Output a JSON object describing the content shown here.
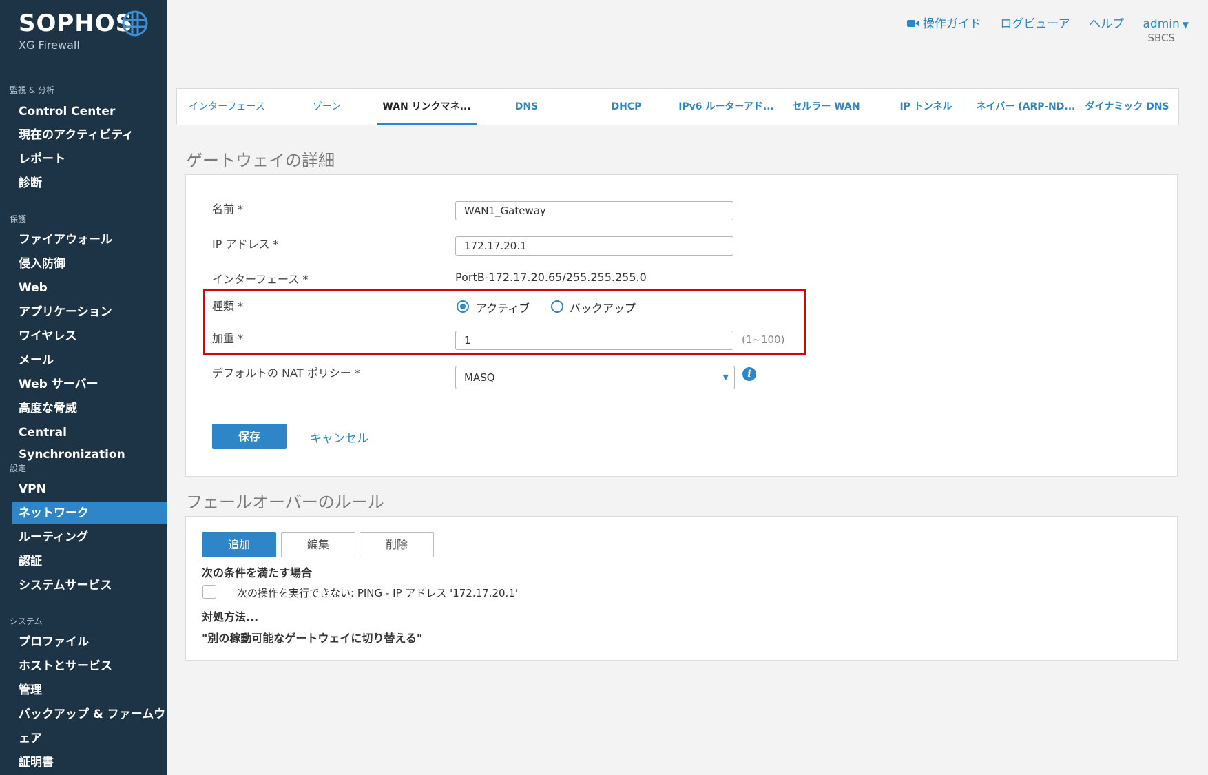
{
  "brand": {
    "name": "SOPHOS",
    "product": "XG Firewall"
  },
  "topbar": {
    "guide": "操作ガイド",
    "log_viewer": "ログビューア",
    "help": "ヘルプ",
    "user": "admin",
    "org": "SBCS"
  },
  "sidebar": {
    "sections": [
      {
        "title": "監視 & 分析",
        "items": [
          "Control Center",
          "現在のアクティビティ",
          "レポート",
          "診断"
        ]
      },
      {
        "title": "保護",
        "items": [
          "ファイアウォール",
          "侵入防御",
          "Web",
          "アプリケーション",
          "ワイヤレス",
          "メール",
          "Web サーバー",
          "高度な脅威",
          "Central Synchronization"
        ]
      },
      {
        "title": "設定",
        "items": [
          "VPN",
          "ネットワーク",
          "ルーティング",
          "認証",
          "システムサービス"
        ]
      },
      {
        "title": "システム",
        "items": [
          "プロファイル",
          "ホストとサービス",
          "管理",
          "バックアップ & ファームウ",
          "ェア",
          "証明書"
        ]
      }
    ],
    "active": "ネットワーク"
  },
  "tabs": [
    "インターフェース",
    "ゾーン",
    "WAN リンクマネ...",
    "DNS",
    "DHCP",
    "IPv6 ルーターアド...",
    "セルラー WAN",
    "IP トンネル",
    "ネイバー (ARP-ND...",
    "ダイナミック DNS"
  ],
  "gateway": {
    "title": "ゲートウェイの詳細",
    "name_label": "名前 *",
    "name_value": "WAN1_Gateway",
    "ip_label": "IP アドレス *",
    "ip_value": "172.17.20.1",
    "iface_label": "インターフェース *",
    "iface_value": "PortB-172.17.20.65/255.255.255.0",
    "type_label": "種類 *",
    "type_active": "アクティブ",
    "type_backup": "バックアップ",
    "weight_label": "加重 *",
    "weight_value": "1",
    "weight_hint": "(1~100)",
    "nat_label": "デフォルトの NAT ポリシー *",
    "nat_value": "MASQ",
    "save": "保存",
    "cancel": "キャンセル"
  },
  "failover": {
    "title": "フェールオーバーのルール",
    "add": "追加",
    "edit": "編集",
    "delete": "削除",
    "condition_heading": "次の条件を満たす場合",
    "condition_rule": "次の操作を実行できない: PING - IP アドレス '172.17.20.1'",
    "action_heading": "対処方法...",
    "action_text": "\"別の稼動可能なゲートウェイに切り替える\""
  },
  "colors": {
    "sidebar": "#1d3446",
    "accent": "#2e86c9",
    "highlight": "#e00000"
  }
}
